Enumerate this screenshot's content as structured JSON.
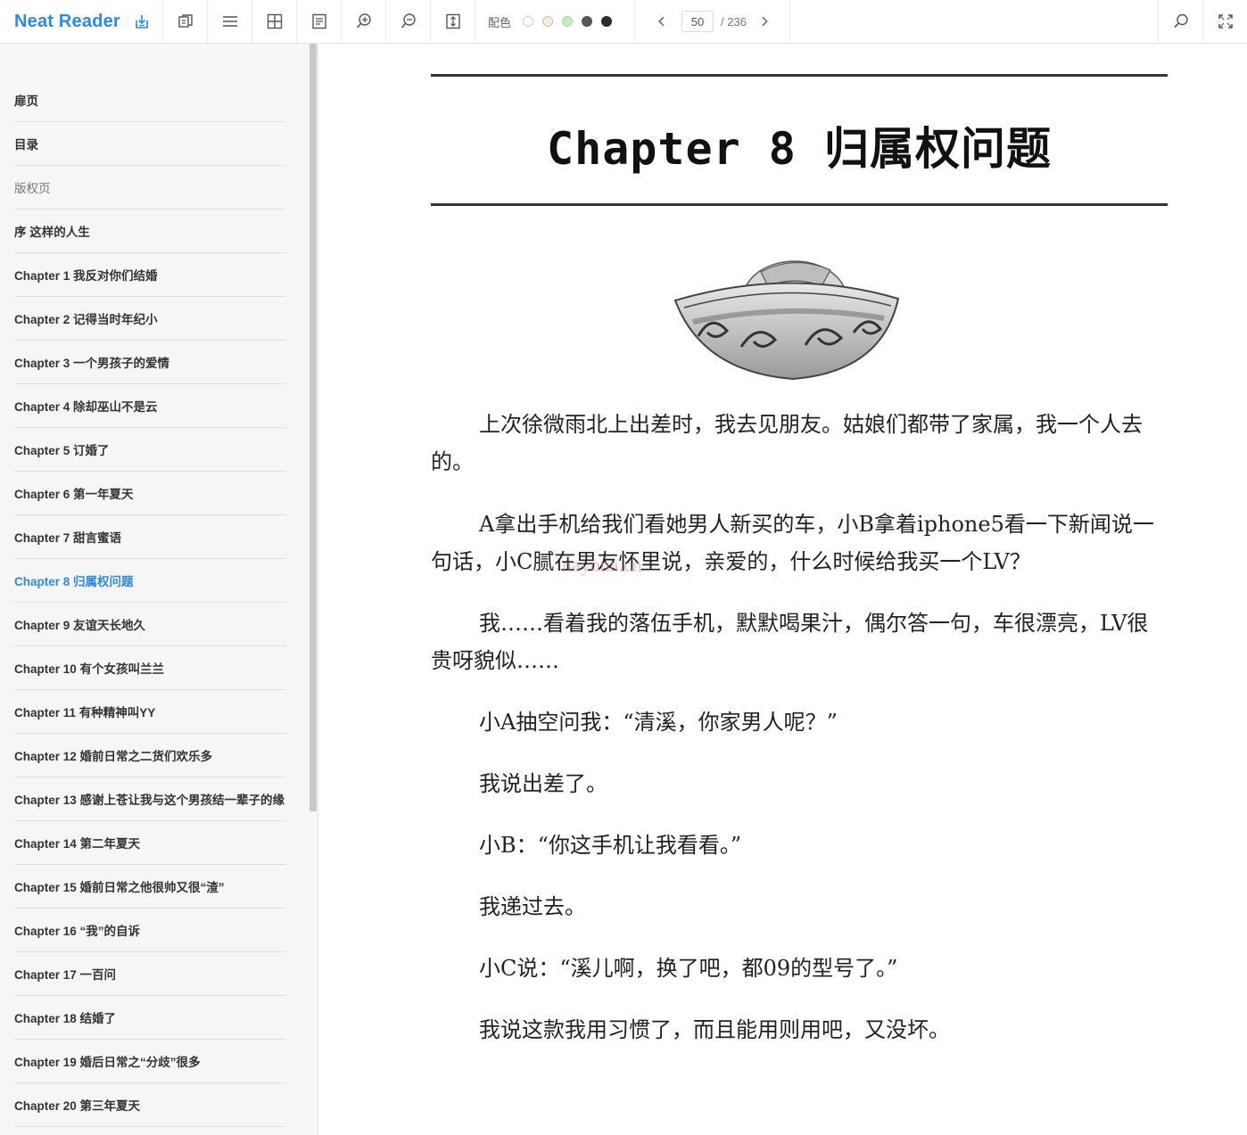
{
  "app": {
    "name": "Neat Reader"
  },
  "toolbar": {
    "color_label": "配色",
    "swatches": [
      "#ffffff",
      "#f3ebe1",
      "#c6e9c0",
      "#555555",
      "#2b2b2b"
    ],
    "page": {
      "current": "50",
      "total": "/ 236"
    }
  },
  "toc": [
    {
      "label": "扉页"
    },
    {
      "label": "目录"
    },
    {
      "label": "版权页"
    },
    {
      "label": "序 这样的人生"
    },
    {
      "label": "Chapter 1 我反对你们结婚"
    },
    {
      "label": "Chapter 2 记得当时年纪小"
    },
    {
      "label": "Chapter 3 一个男孩子的爱情"
    },
    {
      "label": "Chapter 4 除却巫山不是云"
    },
    {
      "label": "Chapter 5 订婚了"
    },
    {
      "label": "Chapter 6 第一年夏天"
    },
    {
      "label": "Chapter 7 甜言蜜语"
    },
    {
      "label": "Chapter 8 归属权问题"
    },
    {
      "label": "Chapter 9 友谊天长地久"
    },
    {
      "label": "Chapter 10 有个女孩叫兰兰"
    },
    {
      "label": "Chapter 11 有种精神叫YY"
    },
    {
      "label": "Chapter 12 婚前日常之二货们欢乐多"
    },
    {
      "label": "Chapter 13 感谢上苍让我与这个男孩结一辈子的缘"
    },
    {
      "label": "Chapter 14 第二年夏天"
    },
    {
      "label": "Chapter 15 婚前日常之他很帅又很“渣”"
    },
    {
      "label": "Chapter 16 “我”的自诉"
    },
    {
      "label": "Chapter 17 一百问"
    },
    {
      "label": "Chapter 18 结婚了"
    },
    {
      "label": "Chapter 19 婚后日常之“分歧”很多"
    },
    {
      "label": "Chapter 20 第三年夏天"
    }
  ],
  "content": {
    "chapter_title": "Chapter 8  归属权问题",
    "watermark": "nayona.cn",
    "paragraphs": [
      "上次徐微雨北上出差时，我去见朋友。姑娘们都带了家属，我一个人去的。",
      "A拿出手机给我们看她男人新买的车，小B拿着iphone5看一下新闻说一句话，小C腻在男友怀里说，亲爱的，什么时候给我买一个LV？",
      "我……看着我的落伍手机，默默喝果汁，偶尔答一句，车很漂亮，LV很贵呀貌似……",
      "小A抽空问我：“清溪，你家男人呢？”",
      "我说出差了。",
      "小B：“你这手机让我看看。”",
      "我递过去。",
      "小C说：“溪儿啊，换了吧，都09的型号了。”",
      "我说这款我用习惯了，而且能用则用吧，又没坏。"
    ]
  }
}
